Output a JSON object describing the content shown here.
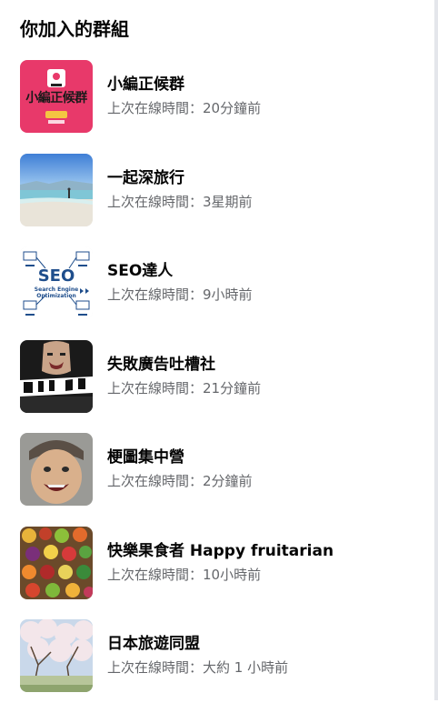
{
  "section": {
    "title": "你加入的群組"
  },
  "groups": [
    {
      "name": "小編正候群",
      "status": "上次在線時間：20分鐘前",
      "thumbnail": {
        "icon": "group-cover-xiaobian",
        "text": "小編正候群",
        "bg": "#e8396a"
      }
    },
    {
      "name": "一起深旅行",
      "status": "上次在線時間：3星期前",
      "thumbnail": {
        "icon": "group-cover-beach",
        "bg": "#6aa8e8"
      }
    },
    {
      "name": "SEO達人",
      "status": "上次在線時間：9小時前",
      "thumbnail": {
        "icon": "group-cover-seo",
        "text": "SEO",
        "subtext": "Search Engine Optimization",
        "bg": "#ffffff"
      }
    },
    {
      "name": "失敗廣告吐槽社",
      "status": "上次在線時間：21分鐘前",
      "thumbnail": {
        "icon": "group-cover-fail",
        "bg": "#1a1a1a"
      }
    },
    {
      "name": "梗圖集中營",
      "status": "上次在線時間：2分鐘前",
      "thumbnail": {
        "icon": "group-cover-meme-face",
        "bg": "#8a8a8a"
      }
    },
    {
      "name": "快樂果食者 Happy fruitarian",
      "status": "上次在線時間：10小時前",
      "thumbnail": {
        "icon": "group-cover-fruits",
        "bg": "#6b4a2a"
      }
    },
    {
      "name": "日本旅遊同盟",
      "status": "上次在線時間：大約 1 小時前",
      "thumbnail": {
        "icon": "group-cover-sakura",
        "bg": "#c9d6e6"
      }
    }
  ]
}
